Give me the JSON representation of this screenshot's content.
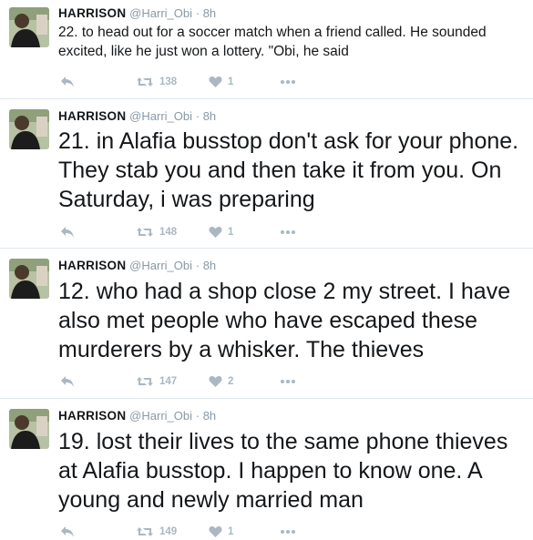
{
  "tweets": [
    {
      "name": "HARRISON",
      "handle": "@Harri_Obi",
      "time": "· 8h",
      "text": "22. to head out for a soccer match when a friend called. He sounded excited, like he just won a lottery. \"Obi, he said",
      "retweets": "138",
      "likes": "1"
    },
    {
      "name": "HARRISON",
      "handle": "@Harri_Obi",
      "time": "· 8h",
      "text": "21. in Alafia busstop don't ask for your phone. They stab you and then take it from you. On Saturday, i was preparing",
      "retweets": "148",
      "likes": "1"
    },
    {
      "name": "HARRISON",
      "handle": "@Harri_Obi",
      "time": "· 8h",
      "text": "12. who had a shop close 2 my street. I have also met people who have escaped these murderers by a whisker. The thieves",
      "retweets": "147",
      "likes": "2"
    },
    {
      "name": "HARRISON",
      "handle": "@Harri_Obi",
      "time": "· 8h",
      "text": "19. lost their lives to the same phone thieves at Alafia busstop. I happen to know one. A young and newly married man",
      "retweets": "149",
      "likes": "1"
    }
  ],
  "icons": {
    "reply": "reply-icon",
    "retweet": "retweet-icon",
    "like": "heart-icon",
    "more": "more-dots-icon"
  },
  "colors": {
    "action_gray": "#aab8c2",
    "meta_gray": "#8899a6",
    "divider": "#e1e8ed"
  }
}
